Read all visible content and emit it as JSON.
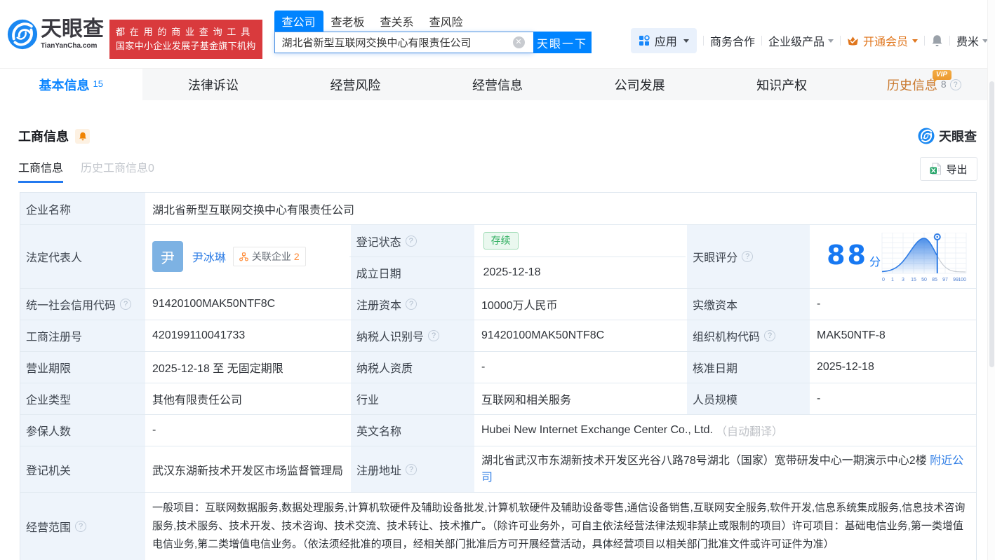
{
  "brand": {
    "name": "天眼查",
    "domain": "TianYanCha.com",
    "slogan_line1": "都在用的商业查询工具",
    "slogan_line2": "国家中小企业发展子基金旗下机构",
    "accent_color": "#0084ff",
    "slogan_bg_color": "#d93a3d"
  },
  "search": {
    "tabs": [
      "查公司",
      "查老板",
      "查关系",
      "查风险"
    ],
    "active_tab": "查公司",
    "query": "湖北省新型互联网交换中心有限责任公司",
    "button": "天眼一下"
  },
  "top_menu": {
    "apps": "应用",
    "cooperation": "商务合作",
    "enterprise": "企业级产品",
    "vip": "开通会员",
    "user": "费米",
    "vip_color": "#e0761d"
  },
  "nav_tabs": [
    {
      "label": "基本信息",
      "count": "15"
    },
    {
      "label": "法律诉讼"
    },
    {
      "label": "经营风险"
    },
    {
      "label": "经营信息"
    },
    {
      "label": "公司发展"
    },
    {
      "label": "知识产权"
    },
    {
      "label": "历史信息",
      "count": "8",
      "vip": "VIP"
    }
  ],
  "section": {
    "title": "工商信息",
    "watermark": "天眼查",
    "tab_current": "工商信息",
    "tab_history": "历史工商信息0",
    "export_label": "导出"
  },
  "fields": {
    "name_label": "企业名称",
    "name": "湖北省新型互联网交换中心有限责任公司",
    "legal_rep_label": "法定代表人",
    "legal_rep_avatar": "尹",
    "legal_rep": "尹冰琳",
    "related_label": "关联企业",
    "related_count": "2",
    "reg_status_label": "登记状态",
    "reg_status": "存续",
    "est_date_label": "成立日期",
    "est_date": "2025-12-18",
    "score_label": "天眼评分",
    "score": "88",
    "score_unit": "分",
    "credit_code_label": "统一社会信用代码",
    "credit_code": "91420100MAK50NTF8C",
    "reg_capital_label": "注册资本",
    "reg_capital": "10000万人民币",
    "paid_capital_label": "实缴资本",
    "paid_capital": "-",
    "reg_number_label": "工商注册号",
    "reg_number": "420199110041733",
    "taxpayer_id_label": "纳税人识别号",
    "taxpayer_id": "91420100MAK50NTF8C",
    "org_code_label": "组织机构代码",
    "org_code": "MAK50NTF-8",
    "term_label": "营业期限",
    "term": "2025-12-18 至 无固定期限",
    "taxpayer_quality_label": "纳税人资质",
    "taxpayer_quality": "-",
    "approval_date_label": "核准日期",
    "approval_date": "2025-12-18",
    "company_type_label": "企业类型",
    "company_type": "其他有限责任公司",
    "industry_label": "行业",
    "industry": "互联网和相关服务",
    "staff_label": "人员规模",
    "staff": "-",
    "insured_label": "参保人数",
    "insured": "-",
    "en_name_label": "英文名称",
    "en_name": "Hubei New Internet Exchange Center Co., Ltd.",
    "en_name_note": "（自动翻译）",
    "authority_label": "登记机关",
    "authority": "武汉东湖新技术开发区市场监督管理局",
    "address_label": "注册地址",
    "address": "湖北省武汉市东湖新技术开发区光谷八路78号湖北（国家）宽带研发中心一期演示中心2楼",
    "address_link": "附近公司",
    "scope_label": "经营范围",
    "scope": "一般项目：互联网数据服务,数据处理服务,计算机软硬件及辅助设备批发,计算机软硬件及辅助设备零售,通信设备销售,互联网安全服务,软件开发,信息系统集成服务,信息技术咨询服务,技术服务、技术开发、技术咨询、技术交流、技术转让、技术推广。（除许可业务外，可自主依法经营法律法规非禁止或限制的项目）许可项目：基础电信业务,第一类增值电信业务,第二类增值电信业务。（依法须经批准的项目，经相关部门批准后方可开展经营活动，具体经营项目以相关部门批准文件或许可证件为准）"
  },
  "chart_data": {
    "type": "area",
    "title": "天眼评分",
    "x_ticks": [
      0,
      1,
      3,
      15,
      50,
      85,
      97,
      99,
      100
    ],
    "score": 88,
    "peak_at": 50,
    "grid": true,
    "curve_color": "#2e7ce5",
    "tail_color": "#c8cdd4",
    "label_color": "#4f7fd0"
  }
}
